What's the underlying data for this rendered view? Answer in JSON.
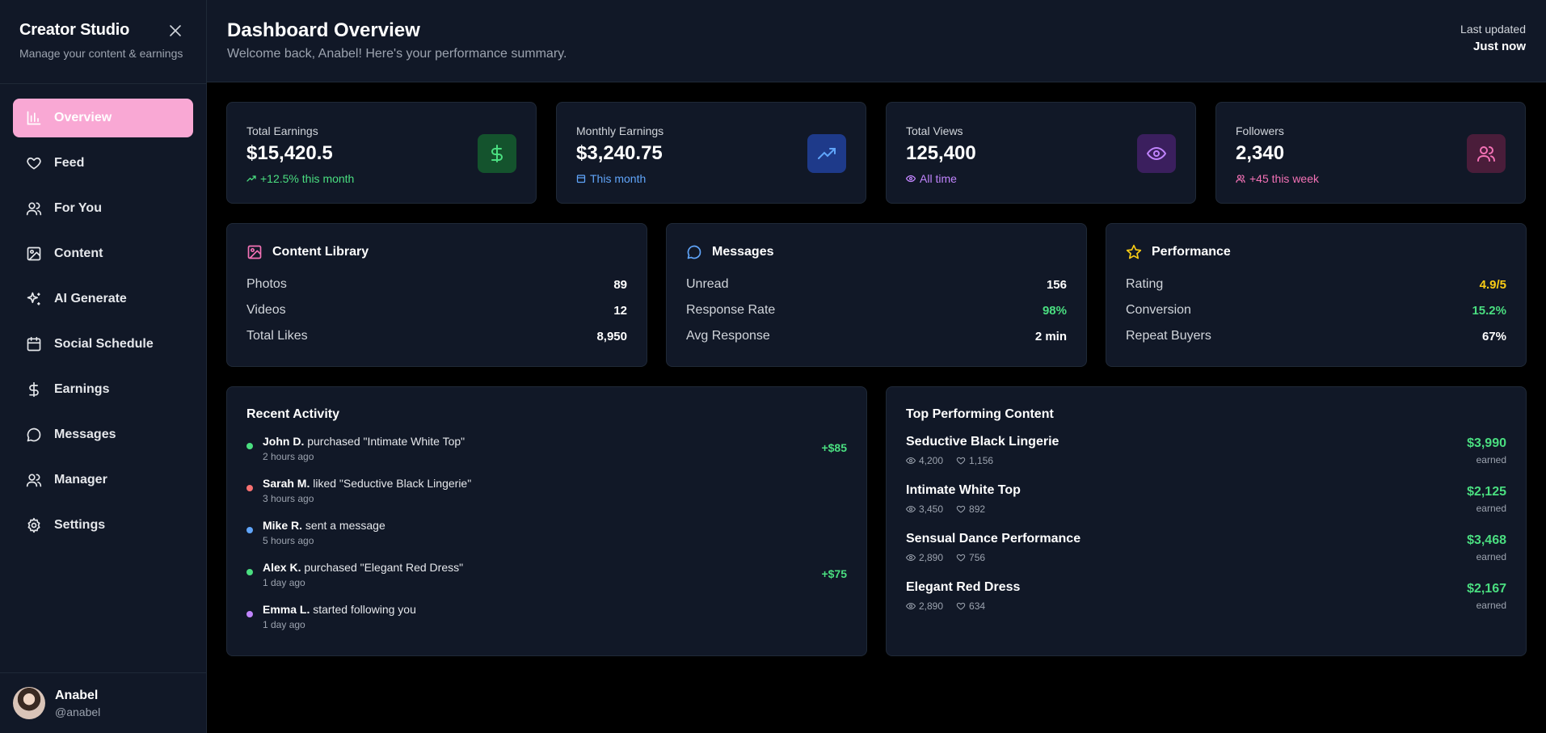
{
  "sidebar": {
    "brand": "Creator Studio",
    "subtitle": "Manage your content & earnings",
    "items": [
      {
        "label": "Overview",
        "icon": "bar-chart-icon"
      },
      {
        "label": "Feed",
        "icon": "heart-icon"
      },
      {
        "label": "For You",
        "icon": "users-icon"
      },
      {
        "label": "Content",
        "icon": "image-icon"
      },
      {
        "label": "AI Generate",
        "icon": "sparkles-icon"
      },
      {
        "label": "Social Schedule",
        "icon": "calendar-icon"
      },
      {
        "label": "Earnings",
        "icon": "dollar-icon"
      },
      {
        "label": "Messages",
        "icon": "message-icon"
      },
      {
        "label": "Manager",
        "icon": "users-icon"
      },
      {
        "label": "Settings",
        "icon": "gear-icon"
      }
    ],
    "user": {
      "name": "Anabel",
      "handle": "@anabel"
    }
  },
  "header": {
    "title": "Dashboard Overview",
    "subtitle": "Welcome back, Anabel! Here's your performance summary.",
    "last_updated_label": "Last updated",
    "last_updated_value": "Just now"
  },
  "stats": [
    {
      "label": "Total Earnings",
      "value": "$15,420.5",
      "note": "+12.5% this month",
      "note_color": "#4ade80",
      "icon": "dollar-icon",
      "icon_bg": "#14532d",
      "icon_color": "#4ade80"
    },
    {
      "label": "Monthly Earnings",
      "value": "$3,240.75",
      "note": "This month",
      "note_color": "#60a5fa",
      "icon": "trending-up-icon",
      "icon_bg": "#1e3a8a",
      "icon_color": "#60a5fa"
    },
    {
      "label": "Total Views",
      "value": "125,400",
      "note": "All time",
      "note_color": "#c084fc",
      "icon": "eye-icon",
      "icon_bg": "#3b1f5e",
      "icon_color": "#c084fc"
    },
    {
      "label": "Followers",
      "value": "2,340",
      "note": "+45 this week",
      "note_color": "#f472b6",
      "icon": "users-icon",
      "icon_bg": "#4a1d3a",
      "icon_color": "#f472b6"
    }
  ],
  "panels": {
    "library": {
      "title": "Content Library",
      "rows": [
        {
          "k": "Photos",
          "v": "89"
        },
        {
          "k": "Videos",
          "v": "12"
        },
        {
          "k": "Total Likes",
          "v": "8,950"
        }
      ]
    },
    "messages": {
      "title": "Messages",
      "rows": [
        {
          "k": "Unread",
          "v": "156"
        },
        {
          "k": "Response Rate",
          "v": "98%"
        },
        {
          "k": "Avg Response",
          "v": "2 min"
        }
      ]
    },
    "performance": {
      "title": "Performance",
      "rows": [
        {
          "k": "Rating",
          "v": "4.9/5"
        },
        {
          "k": "Conversion",
          "v": "15.2%"
        },
        {
          "k": "Repeat Buyers",
          "v": "67%"
        }
      ]
    }
  },
  "activity": {
    "title": "Recent Activity",
    "items": [
      {
        "who": "John D.",
        "what": "purchased \"Intimate White Top\"",
        "time": "2 hours ago",
        "amount": "+$85",
        "dot": "#4ade80"
      },
      {
        "who": "Sarah M.",
        "what": "liked \"Seductive Black Lingerie\"",
        "time": "3 hours ago",
        "amount": "",
        "dot": "#f87171"
      },
      {
        "who": "Mike R.",
        "what": "sent a message",
        "time": "5 hours ago",
        "amount": "",
        "dot": "#60a5fa"
      },
      {
        "who": "Alex K.",
        "what": "purchased \"Elegant Red Dress\"",
        "time": "1 day ago",
        "amount": "+$75",
        "dot": "#4ade80"
      },
      {
        "who": "Emma L.",
        "what": "started following you",
        "time": "1 day ago",
        "amount": "",
        "dot": "#c084fc"
      }
    ]
  },
  "top_content": {
    "title": "Top Performing Content",
    "earned_label": "earned",
    "items": [
      {
        "name": "Seductive Black Lingerie",
        "views": "4,200",
        "likes": "1,156",
        "amount": "$3,990"
      },
      {
        "name": "Intimate White Top",
        "views": "3,450",
        "likes": "892",
        "amount": "$2,125"
      },
      {
        "name": "Sensual Dance Performance",
        "views": "2,890",
        "likes": "756",
        "amount": "$3,468"
      },
      {
        "name": "Elegant Red Dress",
        "views": "2,890",
        "likes": "634",
        "amount": "$2,167"
      }
    ]
  },
  "colors": {
    "accent": "#f9a8d4",
    "positive": "#4ade80",
    "rating": "#facc15"
  }
}
